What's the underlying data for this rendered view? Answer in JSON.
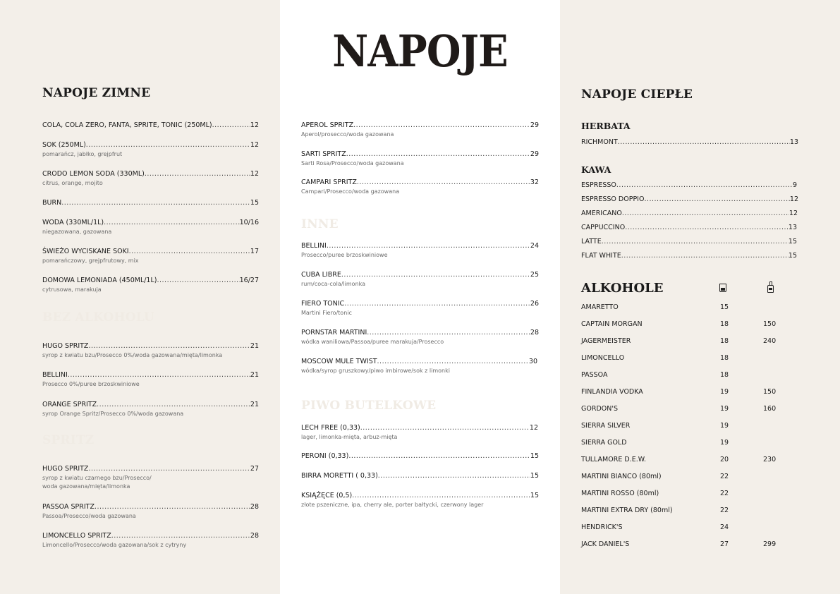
{
  "title": "NAPOJE",
  "cold": {
    "heading": "NAPOJE ZIMNE",
    "items": [
      {
        "name": "COLA, COLA ZERO, FANTA, SPRITE, TONIC (250ML)",
        "price": "12",
        "desc": ""
      },
      {
        "name": "SOK (250ML)",
        "price": "12",
        "desc": "pomarańcz, jabłko, grejpfrut"
      },
      {
        "name": "CRODO LEMON SODA (330ML)",
        "price": "12",
        "desc": "citrus, orange, mojito"
      },
      {
        "name": "BURN",
        "price": "15",
        "desc": ""
      },
      {
        "name": "WODA (330ML/1L)",
        "price": "10/16",
        "desc": "niegazowana, gazowana"
      },
      {
        "name": "ŚWIEŻO WYCISKANE SOKI",
        "price": "17",
        "desc": "pomarańczowy, grejpfrutowy, mix"
      },
      {
        "name": "DOMOWA LEMONIADA (450ML/1L)",
        "price": "16/27",
        "desc": "cytrusowa, marakuja"
      }
    ]
  },
  "zero": {
    "heading": "BEZ ALKOHOLU",
    "items": [
      {
        "name": "HUGO SPRITZ ",
        "price": "21",
        "desc": "syrop z kwiatu bzu/Prosecco 0%/woda gazowana/mięta/limonka"
      },
      {
        "name": "BELLINI",
        "price": "21",
        "desc": "Prosecco 0%/puree brzoskwiniowe"
      },
      {
        "name": "ORANGE SPRITZ ",
        "price": "21",
        "desc": "syrop Orange Spritz/Prosecco 0%/woda gazowana"
      }
    ]
  },
  "spritz_left": {
    "heading": "SPRITZ",
    "items": [
      {
        "name": "HUGO SPRITZ ",
        "price": "27",
        "desc": "syrop z kwiatu czarnego bzu/Prosecco/",
        "desc2": "woda gazowana/mięta/limonka"
      },
      {
        "name": "PASSOA SPRITZ",
        "price": "28",
        "desc": "Passoa/Prosecco/woda gazowana"
      },
      {
        "name": "LIMONCELLO SPRITZ",
        "price": "28",
        "desc": "Limoncello/Prosecco/woda gazowana/sok z cytryny"
      }
    ]
  },
  "spritz_mid": {
    "items": [
      {
        "name": "APEROL SPRITZ ",
        "price": "29",
        "desc": "Aperol/prosecco/woda gazowana"
      },
      {
        "name": "SARTI SPRITZ ",
        "price": "29",
        "desc": "Sarti Rosa/Prosecco/woda gazowana"
      },
      {
        "name": "CAMPARI SPRITZ ",
        "price": "32",
        "desc": "Campari/Prosecco/woda gazowana"
      }
    ]
  },
  "other": {
    "heading": "INNE",
    "items": [
      {
        "name": "BELLINI",
        "price": "24",
        "desc": "Prosecco/puree brzoskwiniowe"
      },
      {
        "name": "CUBA LIBRE ",
        "price": "25",
        "desc": "rum/coca-cola/limonka"
      },
      {
        "name": "FIERO TONIC ",
        "price": "26",
        "desc": "Martini Fiero/tonic"
      },
      {
        "name": "PORNSTAR MARTINI",
        "price": "28",
        "desc": "wódka waniliowa/Passoa/puree marakuja/Prosecco"
      },
      {
        "name": "MOSCOW MULE TWIST",
        "price": "30",
        "desc": "wódka/syrop gruszkowy/piwo imbirowe/sok z limonki"
      }
    ]
  },
  "beer": {
    "heading": "PIWO BUTELKOWE",
    "items": [
      {
        "name": "LECH FREE (0,33)",
        "price": "12",
        "desc": "lager, limonka-mięta, arbuz-mięta"
      },
      {
        "name": "PERONI (0,33)",
        "price": "15",
        "desc": ""
      },
      {
        "name": "BIRRA MORETTI ( 0,33)",
        "price": "15",
        "desc": ""
      },
      {
        "name": "KSIĄŻĘCE (0,5)",
        "price": "15",
        "desc": "złote pszeniczne, ipa, cherry ale, porter bałtycki, czerwony lager"
      }
    ]
  },
  "hot": {
    "heading": "NAPOJE CIEPŁE",
    "tea_heading": "HERBATA",
    "tea": [
      {
        "name": "RICHMONT",
        "price": "13"
      }
    ],
    "coffee_heading": "KAWA",
    "coffee": [
      {
        "name": "ESPRESSO",
        "price": "9"
      },
      {
        "name": "ESPRESSO DOPPIO",
        "price": "12"
      },
      {
        "name": "AMERICANO",
        "price": "12"
      },
      {
        "name": "CAPPUCCINO",
        "price": "13"
      },
      {
        "name": "LATTE",
        "price": "15"
      },
      {
        "name": "FLAT WHITE",
        "price": "15"
      }
    ]
  },
  "alcohol": {
    "heading": "ALKOHOLE",
    "glass_icon": "glass-icon",
    "bottle_icon": "bottle-icon",
    "items": [
      {
        "name": "AMARETTO",
        "glass": "15",
        "bottle": ""
      },
      {
        "name": "CAPTAIN MORGAN",
        "glass": "18",
        "bottle": "150"
      },
      {
        "name": "JAGERMEISTER",
        "glass": "18",
        "bottle": "240"
      },
      {
        "name": "LIMONCELLO",
        "glass": "18",
        "bottle": ""
      },
      {
        "name": "PASSOA",
        "glass": "18",
        "bottle": ""
      },
      {
        "name": "FINLANDIA VODKA",
        "glass": "19",
        "bottle": "150"
      },
      {
        "name": "GORDON'S",
        "glass": "19",
        "bottle": "160"
      },
      {
        "name": "SIERRA SILVER",
        "glass": "19",
        "bottle": ""
      },
      {
        "name": "SIERRA GOLD",
        "glass": "19",
        "bottle": ""
      },
      {
        "name": "TULLAMORE D.E.W.",
        "glass": "20",
        "bottle": "230"
      },
      {
        "name": "MARTINI BIANCO (80ml)",
        "glass": "22",
        "bottle": ""
      },
      {
        "name": "MARTINI ROSSO (80ml)",
        "glass": "22",
        "bottle": ""
      },
      {
        "name": "MARTINI EXTRA DRY (80ml)",
        "glass": "22",
        "bottle": ""
      },
      {
        "name": "HENDRICK'S",
        "glass": "24",
        "bottle": ""
      },
      {
        "name": "JACK DANIEL'S",
        "glass": "27",
        "bottle": "299"
      }
    ]
  }
}
